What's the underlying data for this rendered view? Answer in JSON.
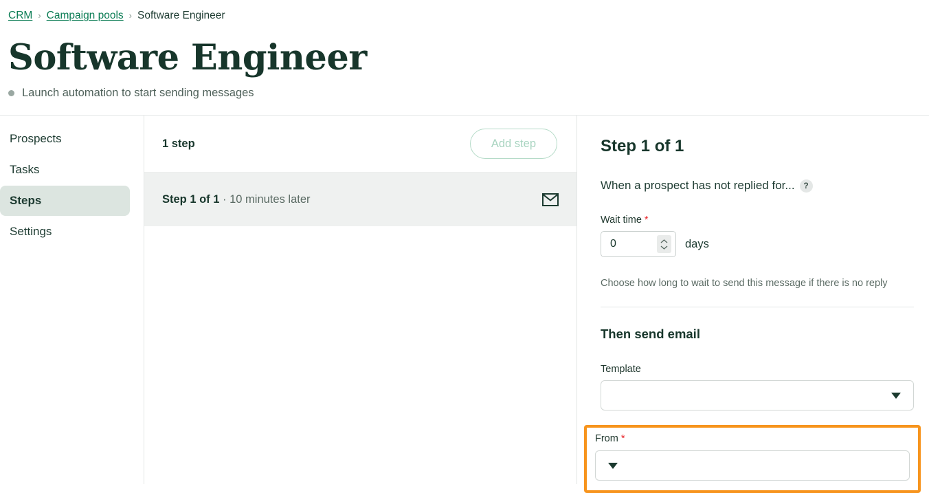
{
  "breadcrumb": {
    "items": [
      {
        "label": "CRM",
        "type": "link"
      },
      {
        "label": "Campaign pools",
        "type": "link"
      },
      {
        "label": "Software Engineer",
        "type": "current"
      }
    ],
    "separator": "›"
  },
  "page": {
    "title": "Software Engineer",
    "status_text": "Launch automation to start sending messages"
  },
  "sidebar": {
    "items": [
      {
        "label": "Prospects",
        "active": false
      },
      {
        "label": "Tasks",
        "active": false
      },
      {
        "label": "Steps",
        "active": true
      },
      {
        "label": "Settings",
        "active": false
      }
    ]
  },
  "steps_panel": {
    "count_label": "1 step",
    "add_button": "Add step",
    "rows": [
      {
        "title": "Step 1 of 1",
        "meta": "· 10 minutes later",
        "icon": "envelope-icon"
      }
    ]
  },
  "detail_panel": {
    "title": "Step 1 of 1",
    "condition_text": "When a prospect has not replied for...",
    "help_glyph": "?",
    "wait_time": {
      "label": "Wait time",
      "required_mark": "*",
      "value": "0",
      "placeholder": "0",
      "unit": "days",
      "hint": "Choose how long to wait to send this message if there is no reply"
    },
    "send_section": {
      "title": "Then send email",
      "template": {
        "label": "Template",
        "value": "",
        "placeholder": ""
      },
      "from": {
        "label": "From",
        "required_mark": "*",
        "value": "",
        "placeholder": ""
      }
    }
  },
  "colors": {
    "accent_green": "#0A7C54",
    "dark_green": "#17362B",
    "active_pill": "#DCE5E0",
    "highlight_orange": "#F7941D",
    "required_red": "#E8262B",
    "row_gray": "#EFF1F0"
  }
}
